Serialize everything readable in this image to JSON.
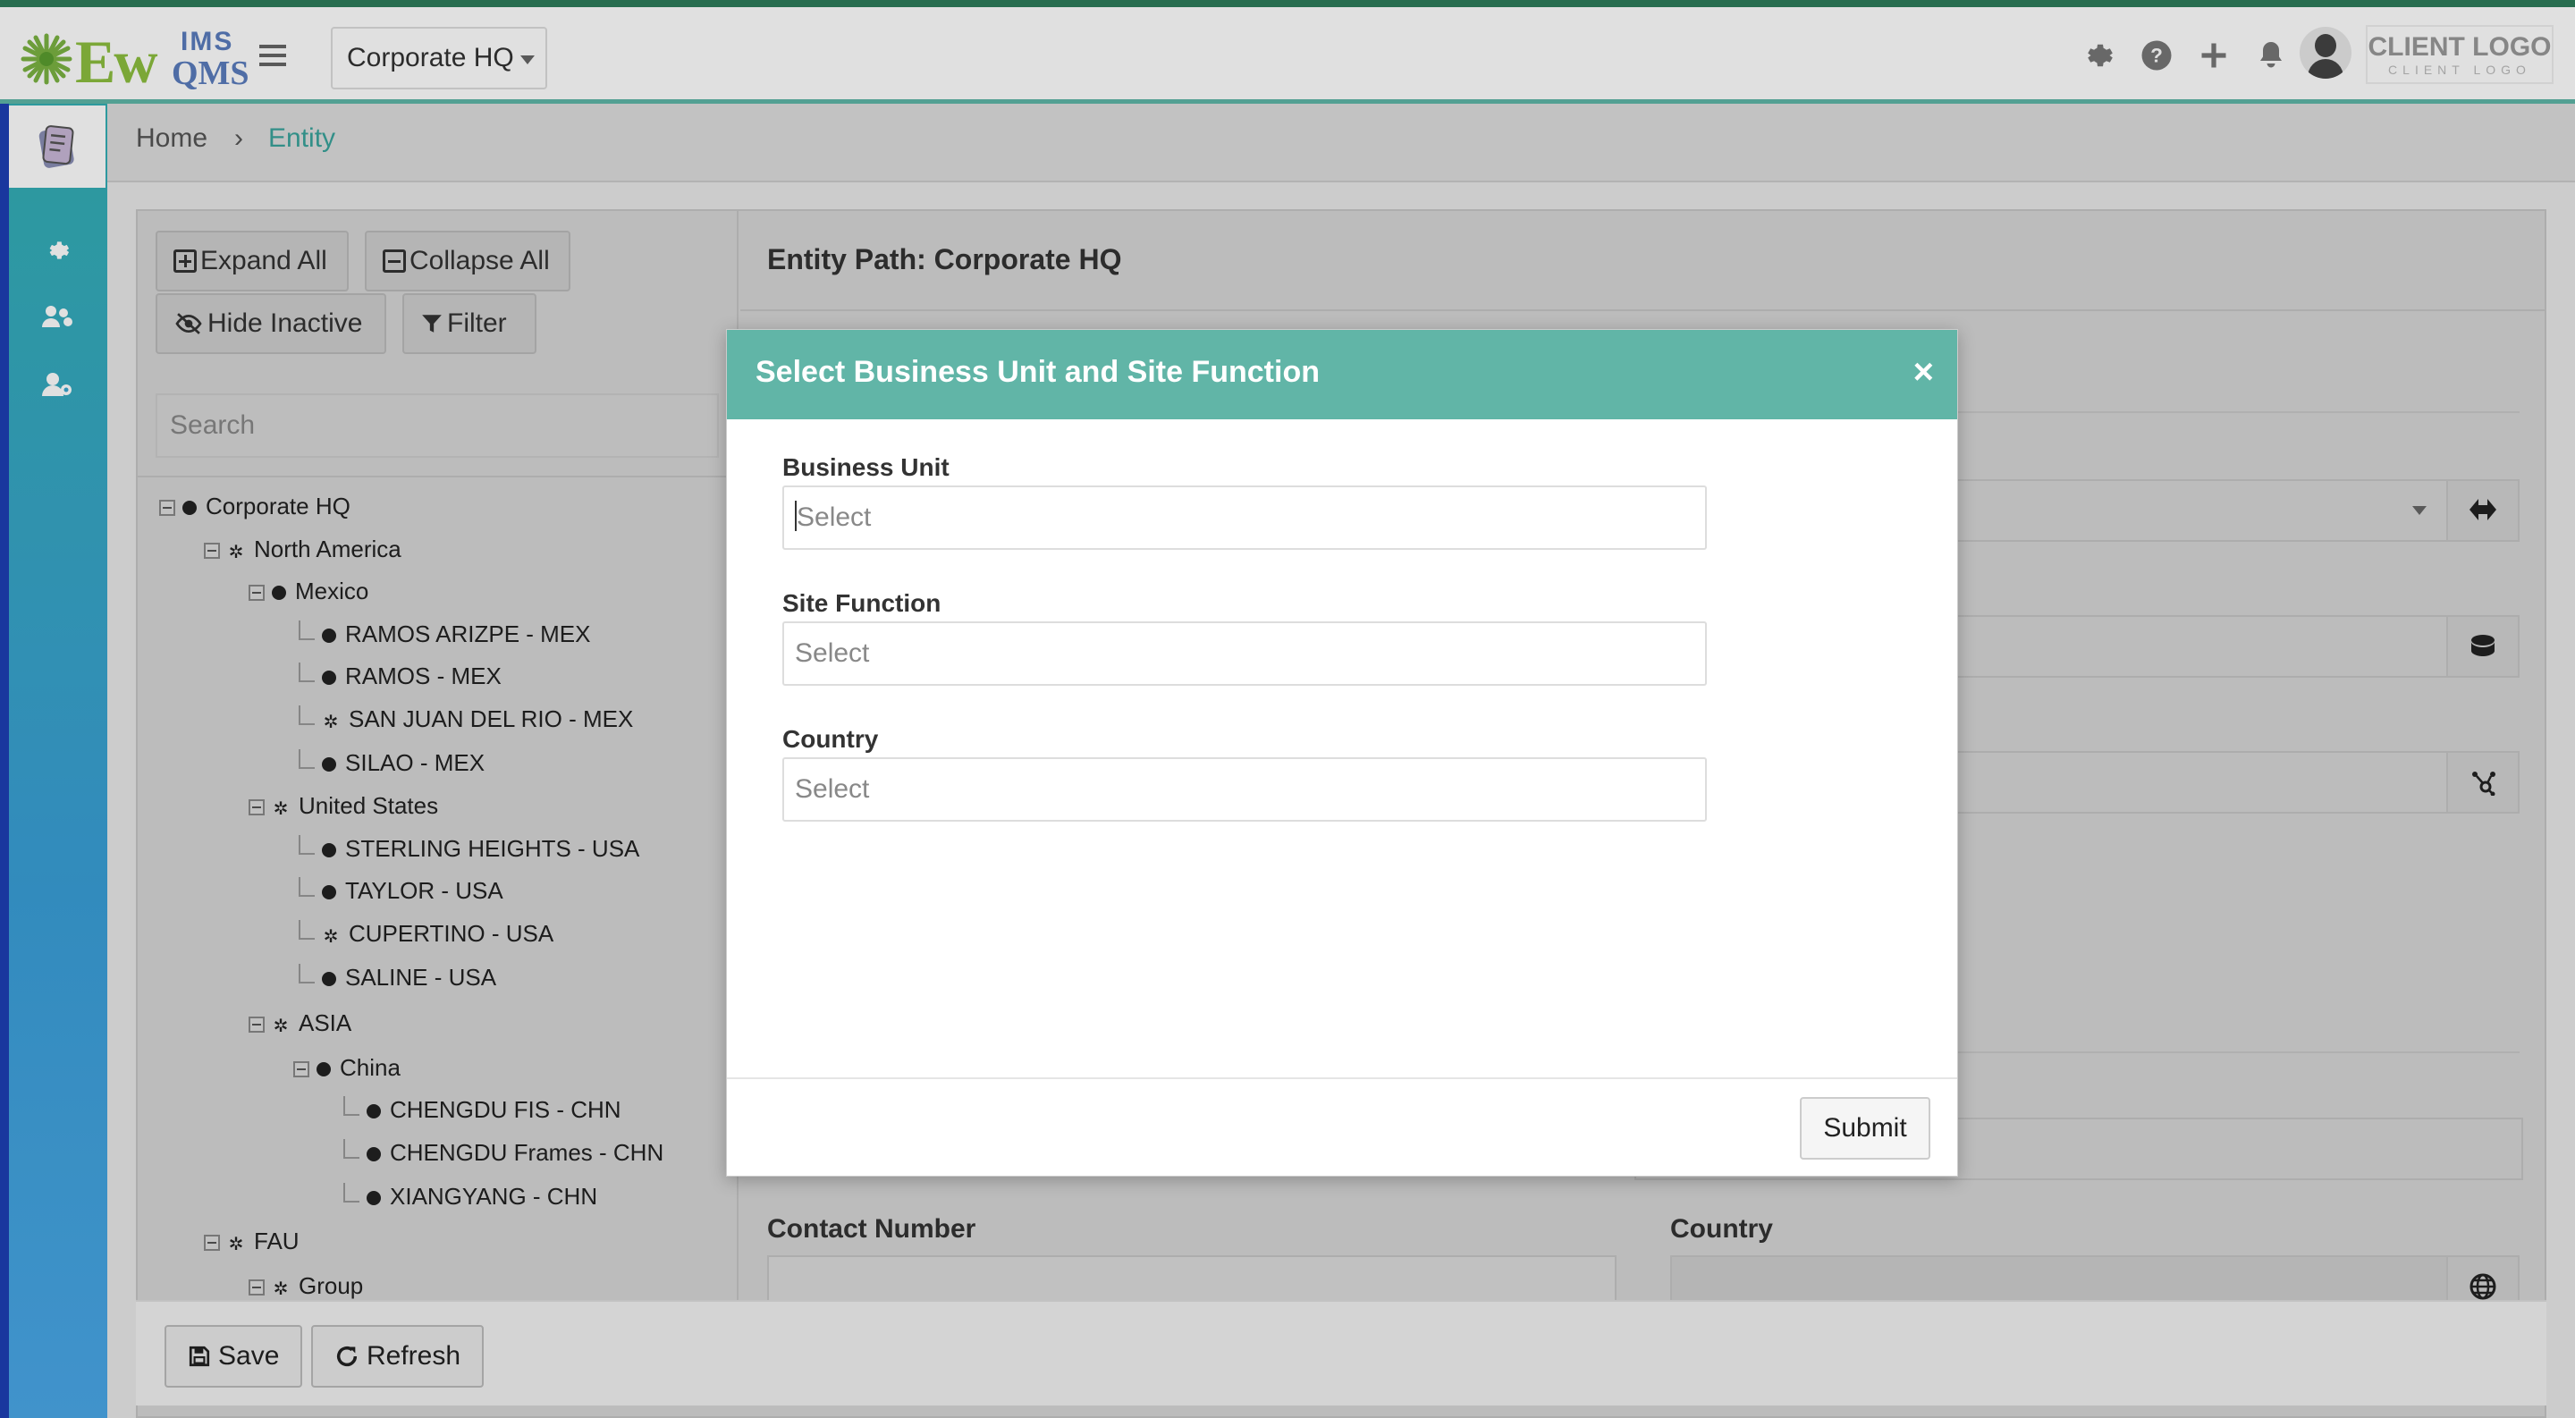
{
  "app": {
    "logo_main": "Ew",
    "logo_ims": "IMS",
    "logo_qms": "QMS",
    "context_selector": "Corporate HQ",
    "client_logo": "CLIENT LOGO",
    "client_logo_sub": "CLIENT LOGO",
    "accent_color": "#61b5a7"
  },
  "header_icons": [
    "gear-icon",
    "help-icon",
    "plus-icon",
    "bell-icon",
    "avatar"
  ],
  "sidebar": {
    "items": [
      "documents-icon",
      "settings-icon",
      "users-icon",
      "user-settings-icon"
    ]
  },
  "breadcrumb": {
    "home": "Home",
    "separator": "›",
    "current": "Entity"
  },
  "tree_toolbar": {
    "expand_all": "Expand All",
    "collapse_all": "Collapse All",
    "hide_inactive": "Hide Inactive",
    "filter": "Filter",
    "search_placeholder": "Search"
  },
  "tree": [
    {
      "label": "Corporate HQ"
    },
    {
      "label": "North America"
    },
    {
      "label": "Mexico"
    },
    {
      "label": "RAMOS ARIZPE - MEX"
    },
    {
      "label": "RAMOS - MEX"
    },
    {
      "label": "SAN JUAN DEL RIO - MEX"
    },
    {
      "label": "SILAO - MEX"
    },
    {
      "label": "United States"
    },
    {
      "label": "STERLING HEIGHTS - USA"
    },
    {
      "label": "TAYLOR - USA"
    },
    {
      "label": "CUPERTINO - USA"
    },
    {
      "label": "SALINE - USA"
    },
    {
      "label": "ASIA"
    },
    {
      "label": "China"
    },
    {
      "label": "CHENGDU FIS - CHN"
    },
    {
      "label": "CHENGDU Frames - CHN"
    },
    {
      "label": "XIANGYANG - CHN"
    },
    {
      "label": "FAU"
    },
    {
      "label": "Group"
    }
  ],
  "entity": {
    "path_label": "Entity Path: Corporate HQ",
    "contact_number_label": "Contact Number",
    "country_label": "Country"
  },
  "footer": {
    "save": "Save",
    "refresh": "Refresh"
  },
  "modal": {
    "title": "Select Business Unit and Site Function",
    "close": "×",
    "business_unit_label": "Business Unit",
    "business_unit_placeholder": "Select",
    "site_function_label": "Site Function",
    "site_function_placeholder": "Select",
    "country_label": "Country",
    "country_placeholder": "Select",
    "submit": "Submit"
  }
}
